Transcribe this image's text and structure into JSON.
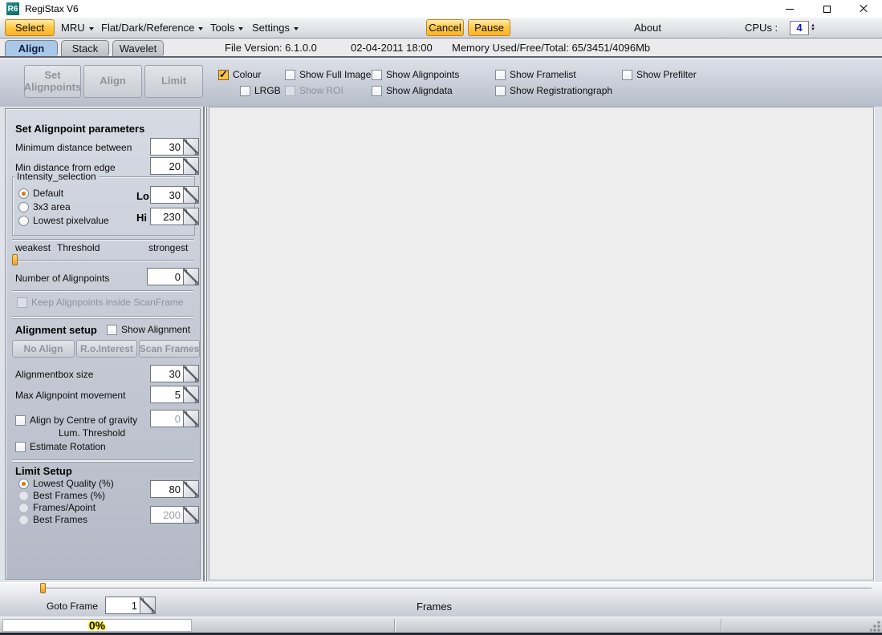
{
  "window": {
    "title": "RegiStax V6",
    "icon_text": "R6"
  },
  "menubar": {
    "select": "Select",
    "mru": "MRU",
    "flat_dark_reference": "Flat/Dark/Reference",
    "tools": "Tools",
    "settings": "Settings",
    "cancel": "Cancel",
    "pause": "Pause",
    "about": "About",
    "cpus_label": "CPUs :",
    "cpus_value": "4"
  },
  "tabbar": {
    "tabs": [
      "Align",
      "Stack",
      "Wavelet"
    ],
    "file_version": "File Version: 6.1.0.0",
    "file_date": "02-04-2011 18:00",
    "memory": "Memory Used/Free/Total: 65/3451/4096Mb"
  },
  "toolbar": {
    "set_alignpoints": "Set Alignpoints",
    "align": "Align",
    "limit": "Limit",
    "colour": "Colour",
    "lrgb": "LRGB",
    "show_full_image": "Show Full Image",
    "show_roi": "Show ROI",
    "show_alignpoints": "Show Alignpoints",
    "show_aligndata": "Show Aligndata",
    "show_framelist": "Show Framelist",
    "show_registrationgraph": "Show Registrationgraph",
    "show_prefilter": "Show Prefilter"
  },
  "alignpoint_params": {
    "title": "Set Alignpoint parameters",
    "min_distance_between_label": "Minimum distance between",
    "min_distance_between_value": "30",
    "min_distance_edge_label": "Min distance from edge",
    "min_distance_edge_value": "20",
    "intensity_title": "Intensity_selection",
    "intensity_options": [
      "Default",
      "3x3 area",
      "Lowest pixelvalue"
    ],
    "lo_label": "Lo",
    "lo_value": "30",
    "hi_label": "Hi",
    "hi_value": "230",
    "weakest": "weakest",
    "threshold_label": "Threshold",
    "strongest": "strongest",
    "number_of_alignpoints_label": "Number of Alignpoints",
    "number_of_alignpoints_value": "0",
    "keep_inside_label": "Keep Alignpoints inside ScanFrame"
  },
  "alignment_setup": {
    "title": "Alignment setup",
    "show_alignment": "Show Alignment",
    "buttons": [
      "No Align",
      "R.o.Interest",
      "Scan Frames"
    ],
    "alignmentbox_size_label": "Alignmentbox size",
    "alignmentbox_size_value": "30",
    "max_movement_label": "Max Alignpoint movement",
    "max_movement_value": "5",
    "centre_gravity_label": "Align by Centre of gravity",
    "centre_gravity_value": "0",
    "lum_threshold": "Lum. Threshold",
    "estimate_rotation": "Estimate Rotation"
  },
  "limit_setup": {
    "title": "Limit Setup",
    "options": [
      "Lowest Quality (%)",
      "Best Frames (%)",
      "Frames/Apoint",
      "Best Frames"
    ],
    "quality_value": "80",
    "frames_value": "200"
  },
  "bottom": {
    "goto_frame_label": "Goto Frame",
    "goto_frame_value": "1",
    "frames_label": "Frames"
  },
  "statusbar": {
    "progress": "0%"
  },
  "colors": {
    "accent_orange": "#FFBE3C",
    "selected_tab_blue": "#A9C7E6",
    "cpu_value_blue": "#1414CC",
    "radio_dot_orange": "#E07B00",
    "progress_glow_yellow": "#FFE700"
  }
}
